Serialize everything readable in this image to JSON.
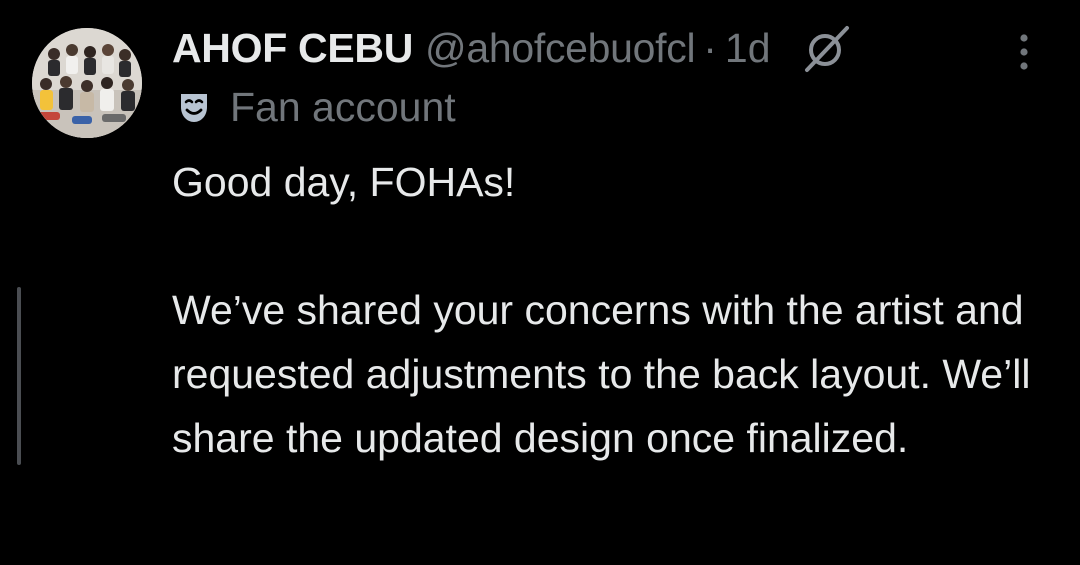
{
  "tweet": {
    "display_name": "AHOF CEBU",
    "handle": "@ahofcebuofcl",
    "separator": "·",
    "time": "1d",
    "label": "Fan account",
    "text_paragraphs": [
      "Good day, FOHAs!",
      "We’ve shared your concerns with the artist and requested adjustments to the back layout. We’ll share the updated design once finalized."
    ]
  },
  "icons": {
    "grok": "grok-icon",
    "more": "more-vertical-icon",
    "label": "theater-mask-icon"
  },
  "colors": {
    "background": "#000000",
    "primary_text": "#e7e9ea",
    "secondary_text": "#71767b",
    "thread_line": "#4a4d52"
  }
}
